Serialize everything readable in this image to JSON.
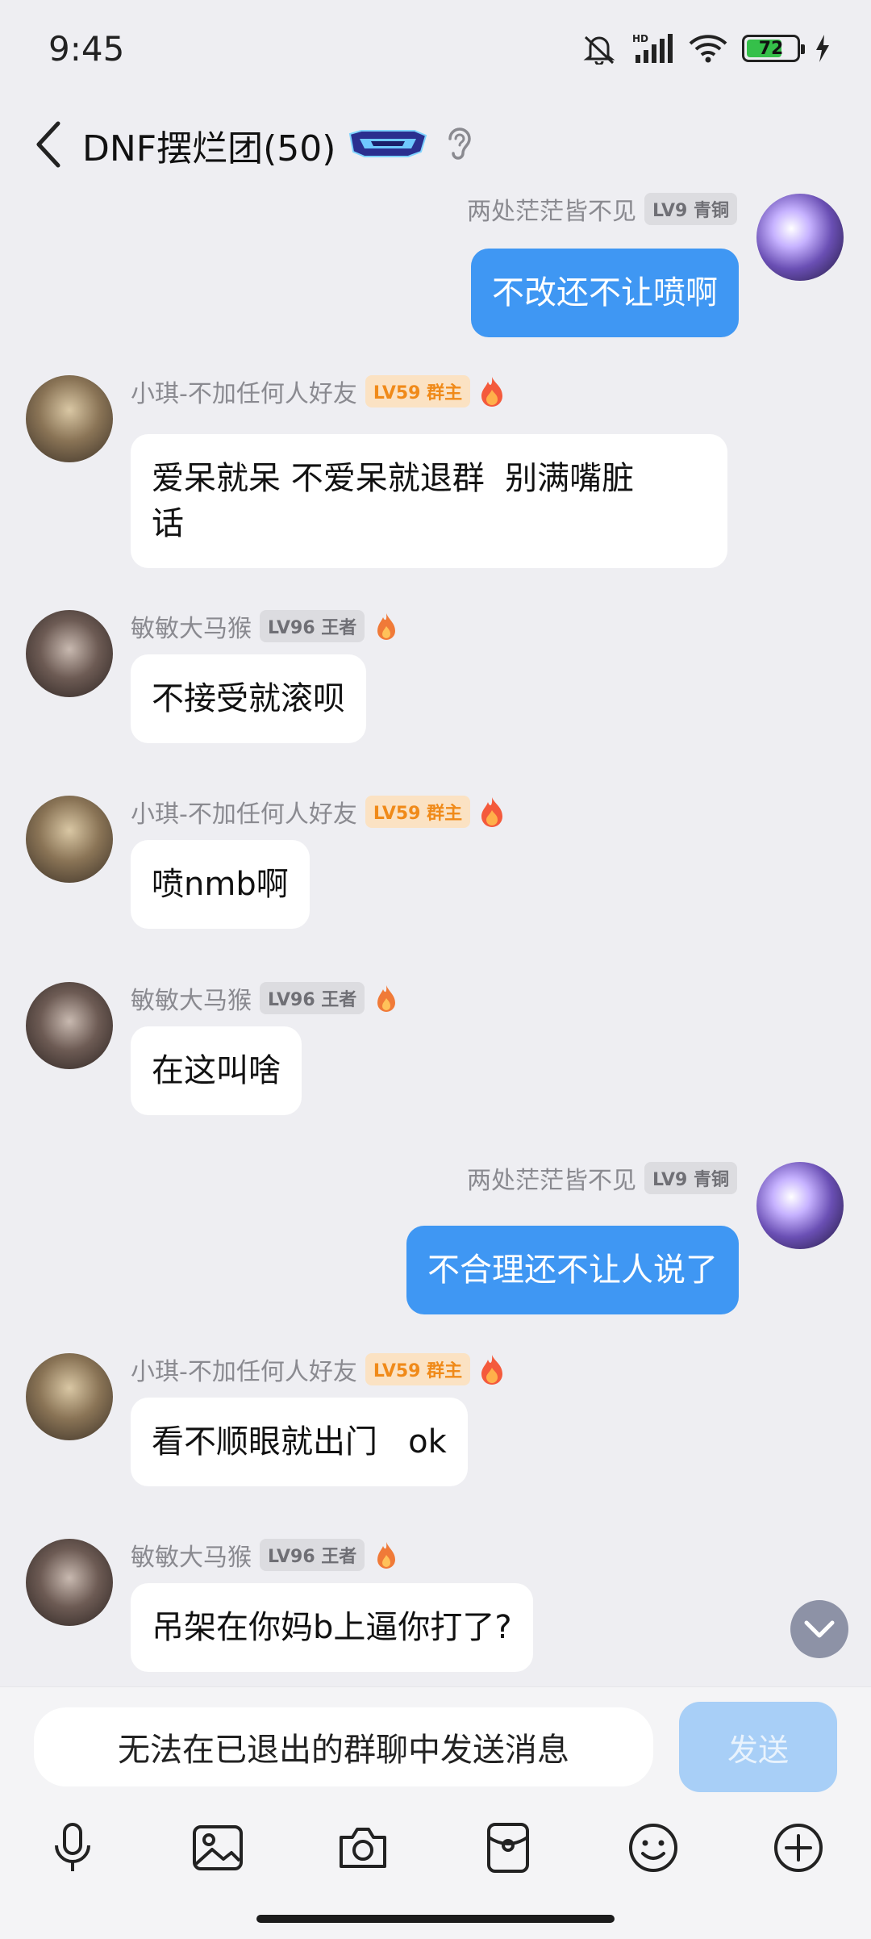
{
  "status_bar": {
    "time": "9:45",
    "battery": "72",
    "battery_level": 0.72
  },
  "header": {
    "title": "DNF摆烂团(50)"
  },
  "messages": [
    {
      "sender": "两处茫茫皆不见",
      "level": "LV9 青铜",
      "text": "不改还不让喷啊",
      "direction": "out",
      "avatar": "anime-girl"
    },
    {
      "sender": "小琪-不加任何人好友",
      "level": "LV59 群主",
      "text": "爱呆就呆 不爱呆就退群  别满嘴脏\n话",
      "direction": "in",
      "avatar": "baby"
    },
    {
      "sender": "敏敏大马猴",
      "level": "LV96 王者",
      "text": "不接受就滚呗",
      "direction": "in",
      "avatar": "couple"
    },
    {
      "sender": "小琪-不加任何人好友",
      "level": "LV59 群主",
      "text": "喷nmb啊",
      "direction": "in",
      "avatar": "baby"
    },
    {
      "sender": "敏敏大马猴",
      "level": "LV96 王者",
      "text": "在这叫啥",
      "direction": "in",
      "avatar": "couple"
    },
    {
      "sender": "两处茫茫皆不见",
      "level": "LV9 青铜",
      "text": "不合理还不让人说了",
      "direction": "out",
      "avatar": "anime-girl"
    },
    {
      "sender": "小琪-不加任何人好友",
      "level": "LV59 群主",
      "text": "看不顺眼就出门   ok",
      "direction": "in",
      "avatar": "baby"
    },
    {
      "sender": "敏敏大马猴",
      "level": "LV96 王者",
      "text": "吊架在你妈b上逼你打了?",
      "direction": "in",
      "avatar": "couple"
    }
  ],
  "input": {
    "disabled_text": "无法在已退出的群聊中发送消息",
    "send_label": "发送"
  },
  "toolbar": [
    "microphone-icon",
    "image-icon",
    "camera-icon",
    "red-packet-icon",
    "emoji-icon",
    "plus-icon"
  ],
  "colors": {
    "background": "#eeeef2",
    "outgoing_bubble": "#3f97f3",
    "incoming_bubble": "#ffffff",
    "owner_badge": "#f08a19",
    "send_button_disabled": "#a8cff7"
  }
}
